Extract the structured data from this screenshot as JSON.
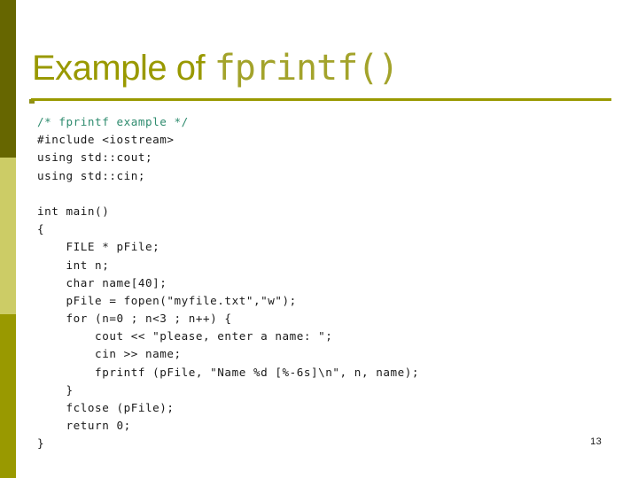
{
  "slide": {
    "title_main": "Example of ",
    "title_code": "fprintf()",
    "page_number": "13",
    "accent_color": "#999900",
    "sidebar_top_color": "#666600",
    "sidebar_middle_color": "#cccc66",
    "sidebar_bottom_color": "#999900",
    "comment_color": "#2e8b6e",
    "code_color": "#1a1a1a"
  },
  "code": {
    "lines": [
      {
        "text": "/* fprintf example */",
        "style": "comment"
      },
      {
        "text": "#include <iostream>",
        "style": "normal"
      },
      {
        "text": "using std::cout;",
        "style": "normal"
      },
      {
        "text": "using std::cin;",
        "style": "normal"
      },
      {
        "text": "",
        "style": "blank"
      },
      {
        "text": "int main()",
        "style": "normal"
      },
      {
        "text": "{",
        "style": "normal"
      },
      {
        "text": "    FILE * pFile;",
        "style": "normal"
      },
      {
        "text": "    int n;",
        "style": "normal"
      },
      {
        "text": "    char name[40];",
        "style": "normal"
      },
      {
        "text": "    pFile = fopen(\"myfile.txt\",\"w\");",
        "style": "normal"
      },
      {
        "text": "    for (n=0 ; n<3 ; n++) {",
        "style": "normal"
      },
      {
        "text": "        cout << \"please, enter a name: \";",
        "style": "normal"
      },
      {
        "text": "        cin >> name;",
        "style": "normal"
      },
      {
        "text": "        fprintf (pFile, \"Name %d [%-6s]\\n\", n, name);",
        "style": "normal"
      },
      {
        "text": "    }",
        "style": "normal"
      },
      {
        "text": "    fclose (pFile);",
        "style": "normal"
      },
      {
        "text": "    return 0;",
        "style": "normal"
      },
      {
        "text": "}",
        "style": "normal"
      }
    ]
  }
}
